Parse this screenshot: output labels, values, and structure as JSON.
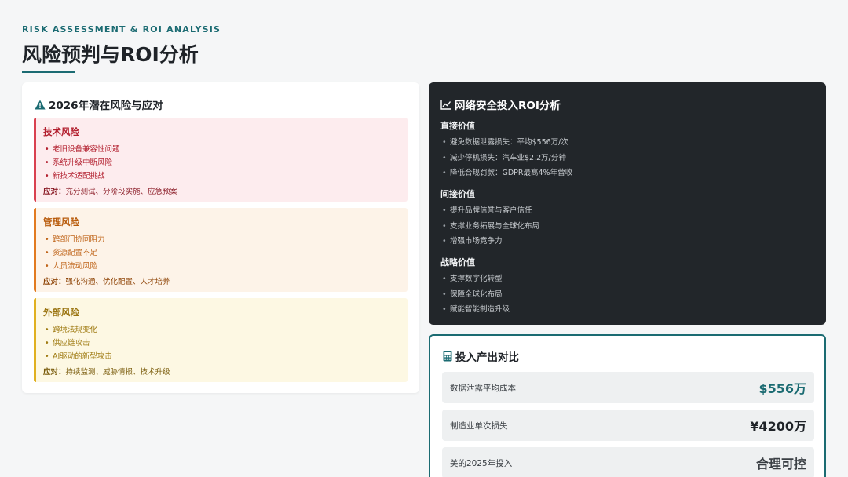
{
  "header": {
    "eyebrow": "RISK ASSESSMENT & ROI ANALYSIS",
    "title": "风险预判与ROI分析"
  },
  "risk_card": {
    "title": "2026年潜在风险与应对",
    "icon": "warning-icon",
    "blocks": [
      {
        "title": "技术风险",
        "items": [
          "老旧设备兼容性问题",
          "系统升级中断风险",
          "新技术适配挑战"
        ],
        "response_label": "应对：",
        "response_text": "充分测试、分阶段实施、应急预案",
        "color": "#d9404f"
      },
      {
        "title": "管理风险",
        "items": [
          "跨部门协同阻力",
          "资源配置不足",
          "人员流动风险"
        ],
        "response_label": "应对：",
        "response_text": "强化沟通、优化配置、人才培养",
        "color": "#e27a1f"
      },
      {
        "title": "外部风险",
        "items": [
          "跨境法规变化",
          "供应链攻击",
          "AI驱动的新型攻击"
        ],
        "response_label": "应对：",
        "response_text": "持续监测、威胁情报、技术升级",
        "color": "#e0b020"
      }
    ]
  },
  "roi_card": {
    "title": "网络安全投入ROI分析",
    "icon": "chart-line-icon",
    "sections": [
      {
        "title": "直接价值",
        "items": [
          "避免数据泄露损失：平均$556万/次",
          "减少停机损失：汽车业$2.2万/分钟",
          "降低合规罚款：GDPR最高4%年营收"
        ]
      },
      {
        "title": "间接价值",
        "items": [
          "提升品牌信誉与客户信任",
          "支撑业务拓展与全球化布局",
          "增强市场竞争力"
        ]
      },
      {
        "title": "战略价值",
        "items": [
          "支撑数字化转型",
          "保障全球化布局",
          "赋能智能制造升级"
        ]
      }
    ]
  },
  "compare_card": {
    "title": "投入产出对比",
    "icon": "calculator-icon",
    "rows": [
      {
        "label": "数据泄露平均成本",
        "value": "$556万"
      },
      {
        "label": "制造业单次损失",
        "value": "¥4200万"
      },
      {
        "label": "美的2025年投入",
        "value": "合理可控"
      }
    ]
  },
  "colors": {
    "accent": "#1b6b72",
    "dark_card": "#22262a"
  }
}
